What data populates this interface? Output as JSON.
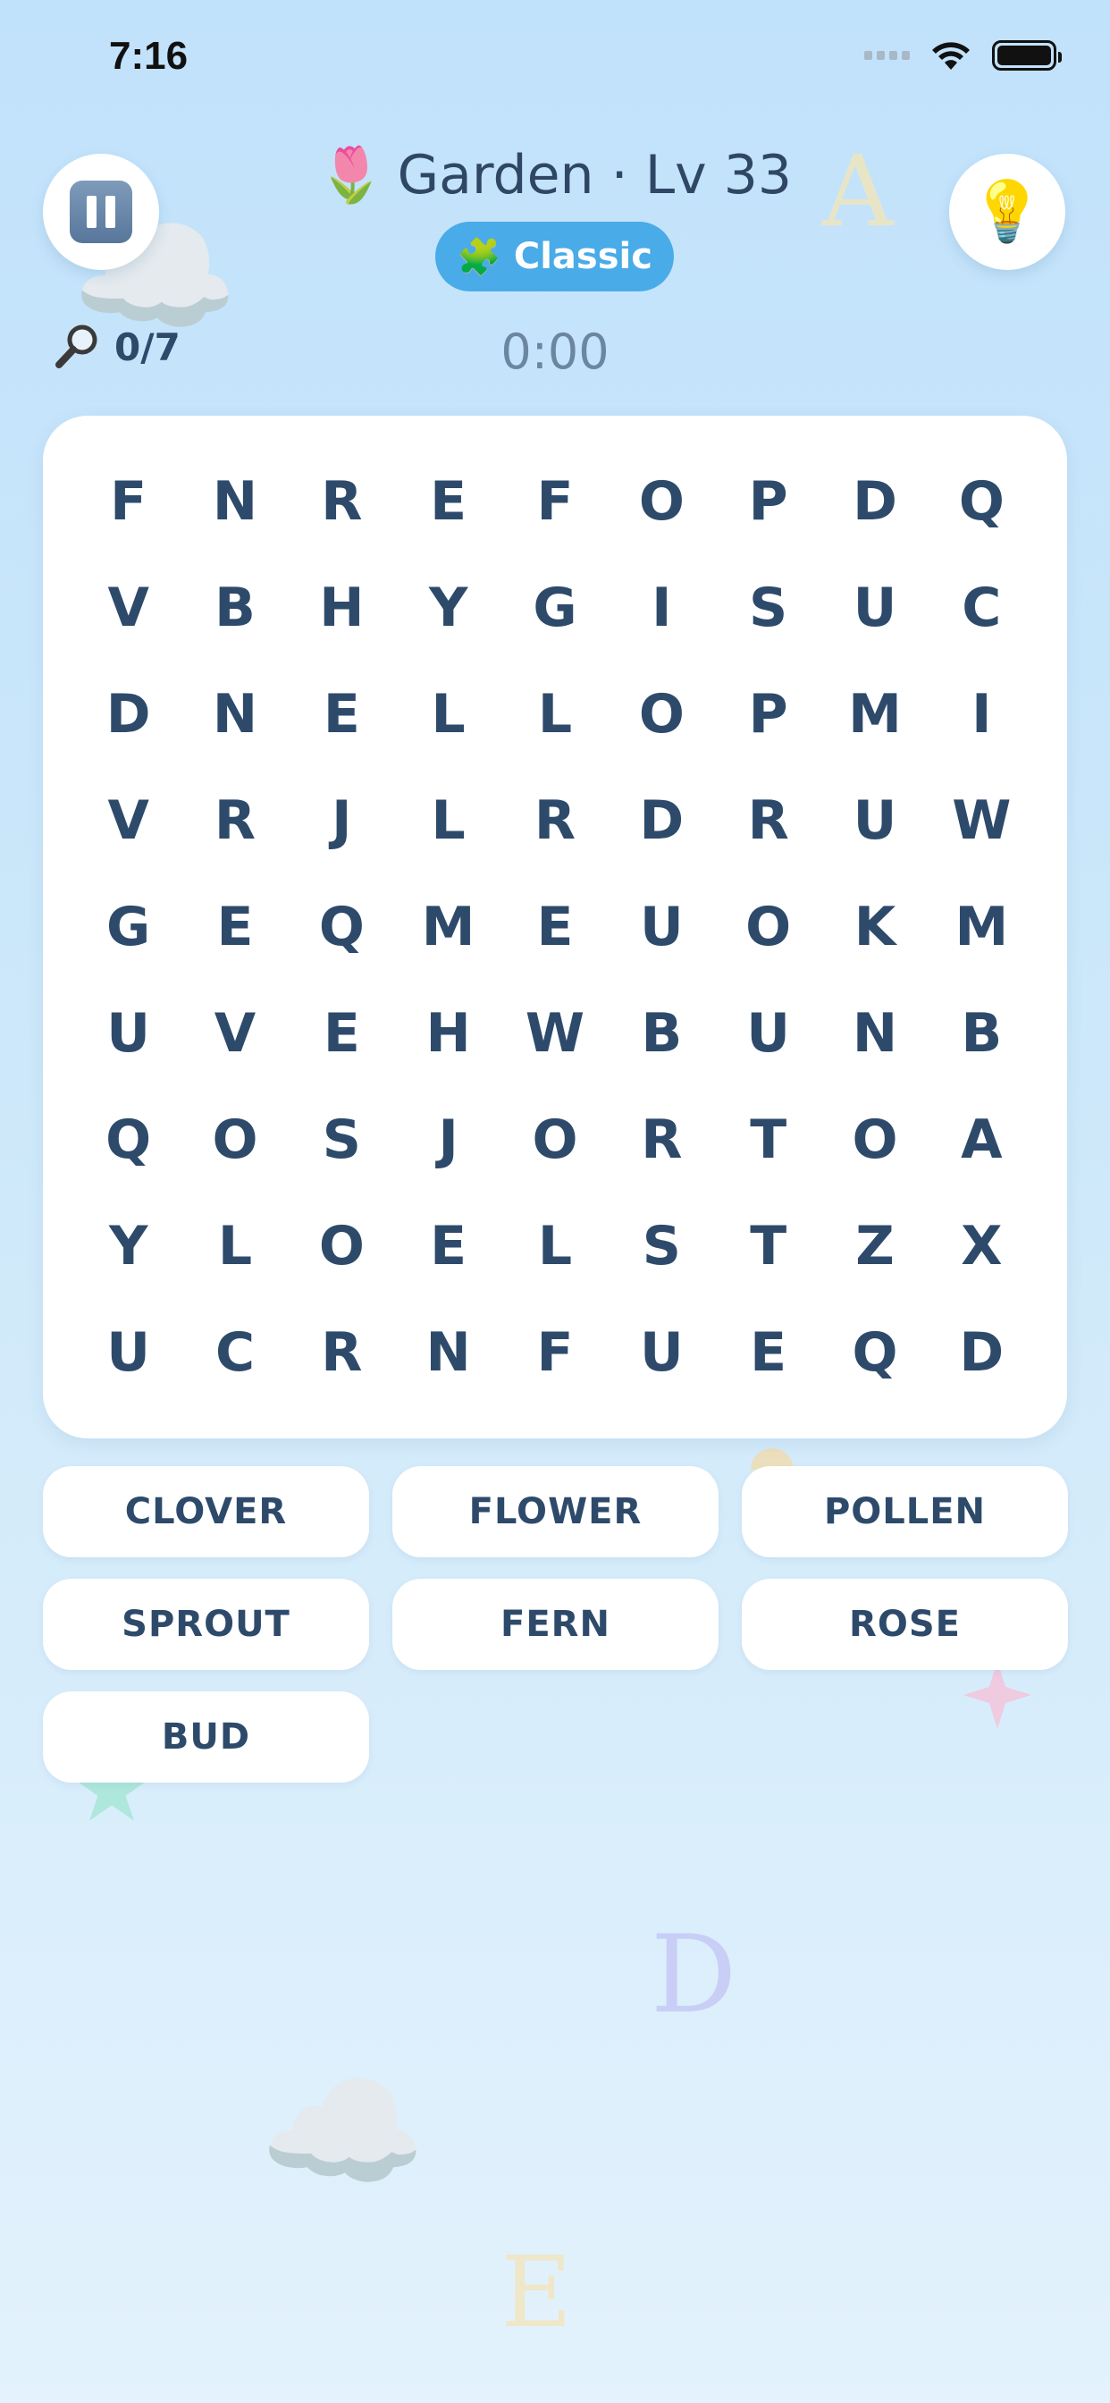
{
  "status_bar": {
    "time": "7:16"
  },
  "header": {
    "theme_emoji": "🌷",
    "title": "Garden · Lv 33",
    "mode_emoji": "🧩",
    "mode": "Classic",
    "found": "0/7",
    "timer": "0:00",
    "hint_emoji": "💡"
  },
  "grid": [
    [
      "F",
      "N",
      "R",
      "E",
      "F",
      "O",
      "P",
      "D",
      "Q"
    ],
    [
      "V",
      "B",
      "H",
      "Y",
      "G",
      "I",
      "S",
      "U",
      "C"
    ],
    [
      "D",
      "N",
      "E",
      "L",
      "L",
      "O",
      "P",
      "M",
      "I"
    ],
    [
      "V",
      "R",
      "J",
      "L",
      "R",
      "D",
      "R",
      "U",
      "W"
    ],
    [
      "G",
      "E",
      "Q",
      "M",
      "E",
      "U",
      "O",
      "K",
      "M"
    ],
    [
      "U",
      "V",
      "E",
      "H",
      "W",
      "B",
      "U",
      "N",
      "B"
    ],
    [
      "Q",
      "O",
      "S",
      "J",
      "O",
      "R",
      "T",
      "O",
      "A"
    ],
    [
      "Y",
      "L",
      "O",
      "E",
      "L",
      "S",
      "T",
      "Z",
      "X"
    ],
    [
      "U",
      "C",
      "R",
      "N",
      "F",
      "U",
      "E",
      "Q",
      "D"
    ]
  ],
  "words": [
    "CLOVER",
    "FLOWER",
    "POLLEN",
    "SPROUT",
    "FERN",
    "ROSE",
    "BUD"
  ],
  "decorations": {
    "letter_a": "A",
    "letter_d": "D",
    "letter_e": "E",
    "cloud": "☁️"
  },
  "colors": {
    "mode_pill": "#49abe8",
    "letters": "#2e4a6b",
    "background_top": "#c1e2fb"
  }
}
